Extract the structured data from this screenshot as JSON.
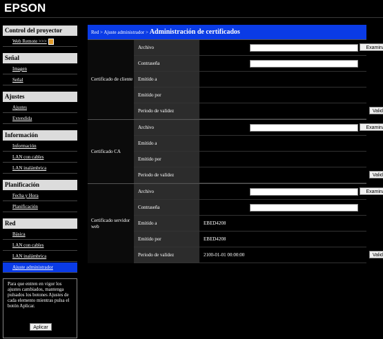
{
  "brand": "EPSON",
  "sidebar": {
    "sections": [
      {
        "title": "Control del proyector",
        "items": [
          "Web Remote >>>"
        ]
      },
      {
        "title": "Señal",
        "items": [
          "Imagen",
          "Señal"
        ]
      },
      {
        "title": "Ajustes",
        "items": [
          "Ajustes",
          "Extendida"
        ]
      },
      {
        "title": "Información",
        "items": [
          "Información",
          "LAN con cables",
          "LAN inalámbrica"
        ]
      },
      {
        "title": "Planificación",
        "items": [
          "Fecha y Hora",
          "Planificación"
        ]
      },
      {
        "title": "Red",
        "items": [
          "Básica",
          "LAN con cables",
          "LAN inalámbrica",
          "Ajuste administrador"
        ]
      }
    ],
    "note": "Para que entren en vigor los ajustes cambiados, mantenga pulsados los botones Ajustes de cada elemento mientras pulsa el botón Aplicar.",
    "apply_label": "Aplicar"
  },
  "header": {
    "breadcrumb": "Red > Ajuste administrador > ",
    "title": "Administración de certificados"
  },
  "groups": [
    {
      "label": "Certificado de cliente",
      "rows": {
        "archivo": "Archivo",
        "contrasena": "Contraseña",
        "emitido_a": "Emitido a",
        "emitido_por": "Emitido por",
        "periodo": "Periodo de validez"
      },
      "values": {
        "emitido_a": "",
        "emitido_por": "",
        "periodo": ""
      }
    },
    {
      "label": "Certificado CA",
      "rows": {
        "archivo": "Archivo",
        "emitido_a": "Emitido a",
        "emitido_por": "Emitido por",
        "periodo": "Periodo de validez"
      },
      "values": {
        "emitido_a": "",
        "emitido_por": "",
        "periodo": ""
      }
    },
    {
      "label": "Certificado servidor web",
      "rows": {
        "archivo": "Archivo",
        "contrasena": "Contraseña",
        "emitido_a": "Emitido a",
        "emitido_por": "Emitido por",
        "periodo": "Periodo de validez"
      },
      "values": {
        "emitido_a": "EBED4208",
        "emitido_por": "EBED4208",
        "periodo": "2100-01-01 00:00:00"
      }
    }
  ],
  "buttons": {
    "browse": "Examinar...",
    "validate": "Validar"
  }
}
